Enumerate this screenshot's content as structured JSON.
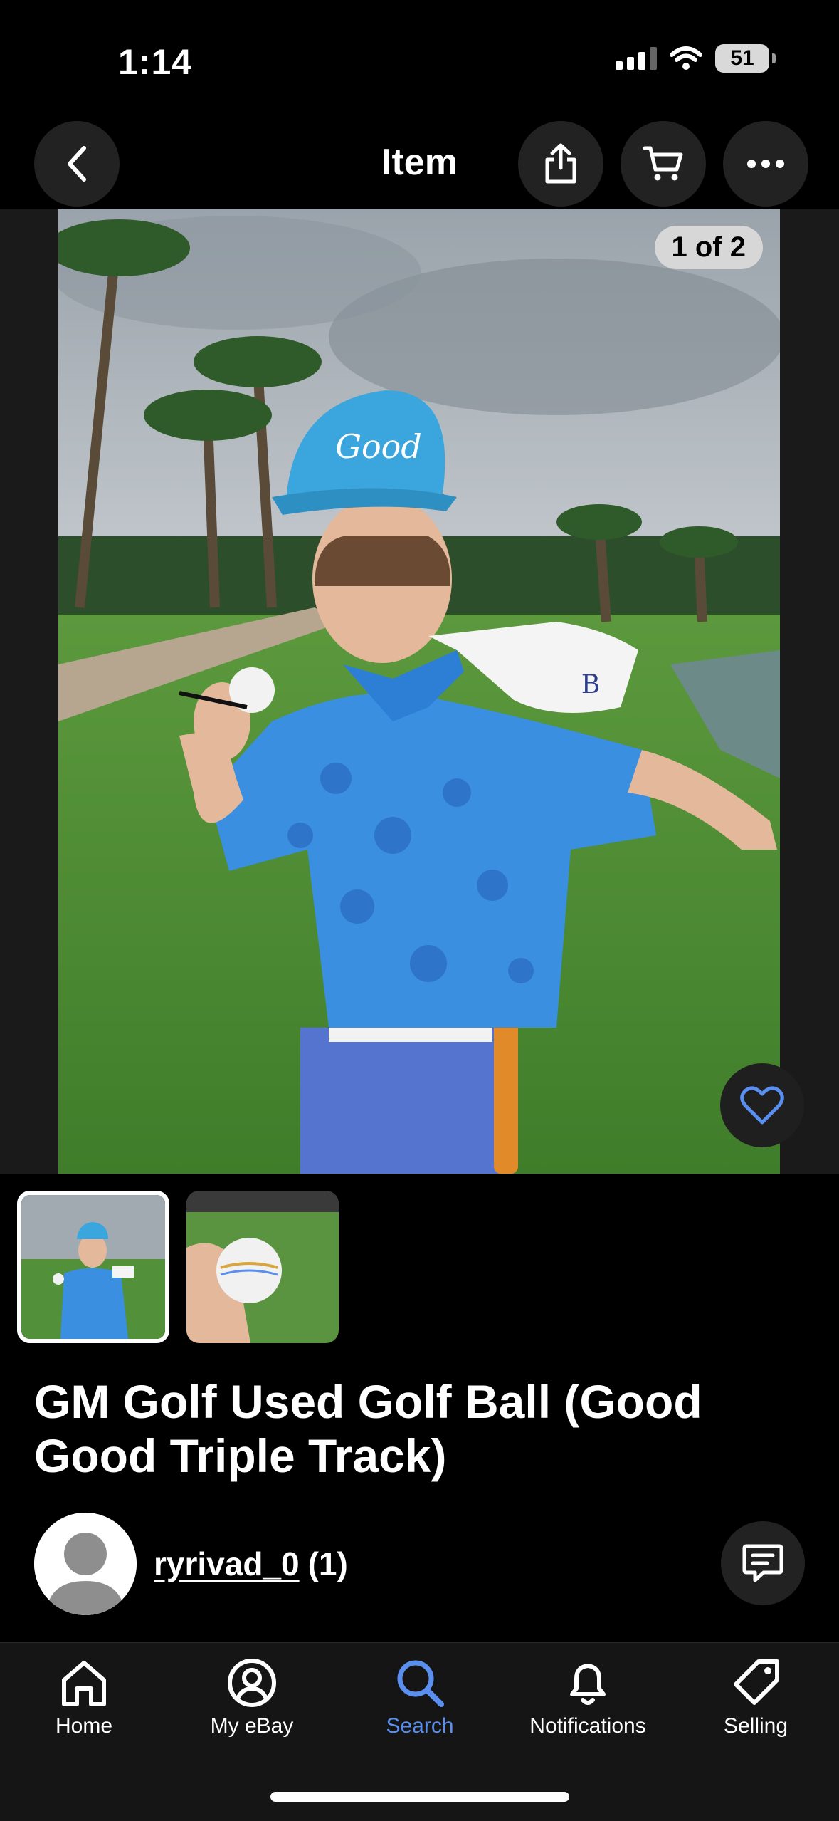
{
  "status_bar": {
    "time": "1:14",
    "battery": "51"
  },
  "header": {
    "title": "Item"
  },
  "gallery": {
    "counter": "1 of 2",
    "hat_text": "Good"
  },
  "listing": {
    "title": "GM Golf Used Golf Ball (Good Good Triple Track)"
  },
  "seller": {
    "name": "ryrivad_0",
    "feedback": "(1)"
  },
  "tabbar": {
    "items": [
      {
        "label": "Home",
        "icon": "home-icon"
      },
      {
        "label": "My eBay",
        "icon": "user-icon"
      },
      {
        "label": "Search",
        "icon": "search-icon"
      },
      {
        "label": "Notifications",
        "icon": "bell-icon"
      },
      {
        "label": "Selling",
        "icon": "tag-icon"
      }
    ],
    "active": "Search"
  },
  "colors": {
    "accent": "#5a8ff0",
    "background": "#000000",
    "surface": "#222222"
  }
}
